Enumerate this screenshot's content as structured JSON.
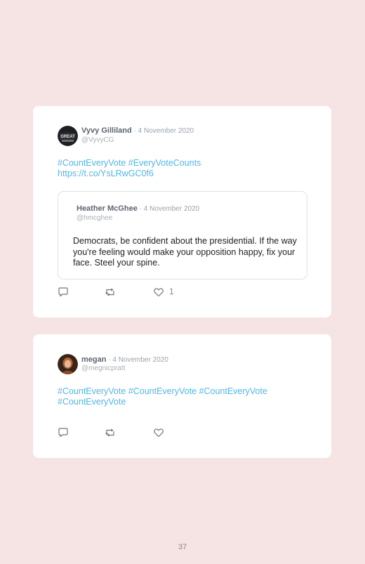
{
  "tweets": [
    {
      "author": "Vyvy Gilliland",
      "date": " · 4 November 2020",
      "handle": "@VyvyCG",
      "text_line1": "#CountEveryVote #EveryVoteCounts",
      "text_line2": "https://t.co/YsLRwGC0f6",
      "avatar_text": "GREAT",
      "quoted": {
        "author": "Heather McGhee",
        "date": " · 4 November 2020",
        "handle": "@hmcghee",
        "text": "Democrats, be confident about the presidential. If the way you're feeling would make your opposition happy, fix your face. Steel your spine."
      },
      "likes": "1",
      "icons": [
        "reply-icon",
        "retweet-icon",
        "heart-icon"
      ]
    },
    {
      "author": "megan",
      "date": " · 4 November 2020",
      "handle": "@megnicpratt",
      "text_line1": "#CountEveryVote #CountEveryVote #CountEveryVote",
      "text_line2": "#CountEveryVote",
      "icons": [
        "reply-icon",
        "retweet-icon",
        "heart-icon"
      ]
    }
  ],
  "page_number": "37",
  "colors": {
    "background": "#f5e4e3",
    "hashtag": "#52b6e6",
    "name": "#5c6671",
    "muted": "#a7b0b7"
  }
}
